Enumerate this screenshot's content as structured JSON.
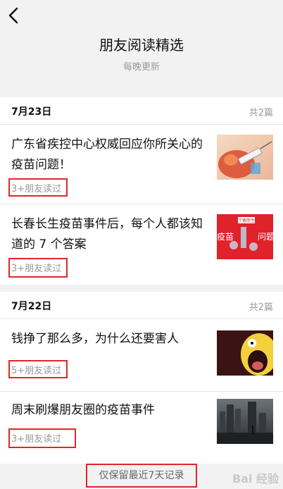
{
  "header": {
    "back_icon": "chevron-left-icon",
    "title": "朋友阅读精选",
    "subtitle": "每晚更新"
  },
  "groups": [
    {
      "date": "7月23日",
      "count": "共2篇",
      "items": [
        {
          "title": "广东省疾控中心权威回应你所关心的疫苗问题！",
          "readers": "3+朋友读过",
          "thumb": "vaccine-syringe-photo"
        },
        {
          "title": "长春长生疫苗事件后，每个人都该知道的 7 个答案",
          "readers": "3+朋友读过",
          "thumb": "vaccine-question-graphic",
          "thumb_text_left": "疫苗",
          "thumb_text_right": "问题",
          "thumb_tag": "丁香医生"
        }
      ]
    },
    {
      "date": "7月22日",
      "count": "共2篇",
      "items": [
        {
          "title": "钱挣了那么多，为什么还要害人",
          "readers": "5+朋友读过",
          "thumb": "cartoon-screaming-face"
        },
        {
          "title": "周末刷爆朋友圈的疫苗事件",
          "readers": "3+朋友读过",
          "thumb": "city-skyline-photo"
        }
      ]
    }
  ],
  "footer": {
    "note": "仅保留最近7天记录"
  },
  "watermark": "Bai 经验",
  "colors": {
    "annotation": "#e0262b",
    "background": "#f2f2f2",
    "muted": "#999999"
  }
}
